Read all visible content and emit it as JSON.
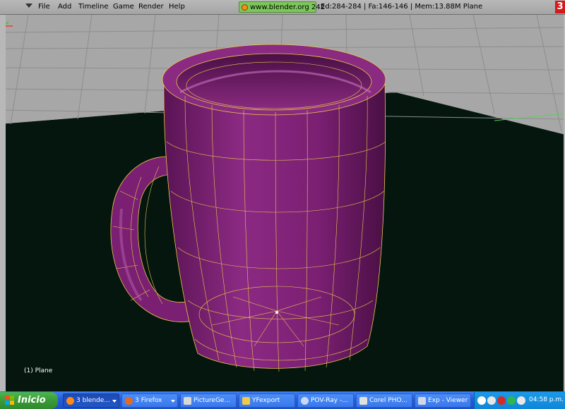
{
  "menubar": {
    "items": [
      "File",
      "Add",
      "Timeline",
      "Game",
      "Render",
      "Help"
    ],
    "url": "www.blender.org 242",
    "stats": "Ed:284-284 | Fa:146-146 | Mem:13.88M Plane",
    "scene_badge": "3"
  },
  "viewport": {
    "object_label": "(1) Plane",
    "colors": {
      "grid_floor": "#a7a7a7",
      "background": "#04160e",
      "mesh": "#7a1f72",
      "wire": "#e8c84a"
    }
  },
  "taskbar": {
    "start_label": "Inicio",
    "tasks": [
      {
        "label": "3 blende...",
        "icon": "blender-icon",
        "active": true,
        "grouped": true
      },
      {
        "label": "3 Firefox",
        "icon": "firefox-icon",
        "active": false,
        "grouped": true
      },
      {
        "label": "PictureGe...",
        "icon": "picture-icon",
        "active": false,
        "grouped": false
      },
      {
        "label": "YFexport",
        "icon": "folder-icon",
        "active": false,
        "grouped": false
      },
      {
        "label": "POV-Ray -...",
        "icon": "povray-icon",
        "active": false,
        "grouped": false
      },
      {
        "label": "Corel PHO...",
        "icon": "corel-icon",
        "active": false,
        "grouped": false
      },
      {
        "label": "Exp - Viewer",
        "icon": "viewer-icon",
        "active": false,
        "grouped": false
      }
    ],
    "clock": "04:58 p.m."
  }
}
